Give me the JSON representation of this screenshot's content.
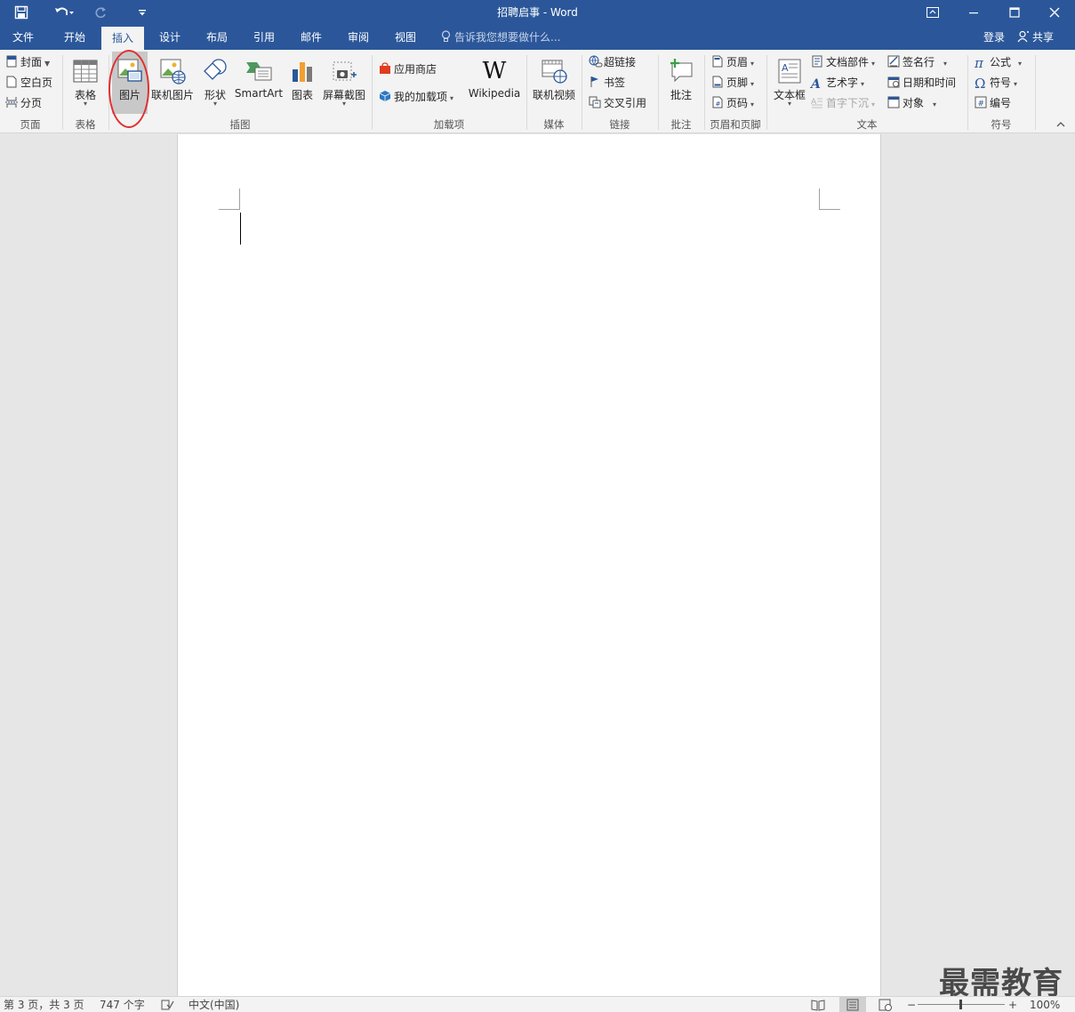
{
  "titlebar": {
    "title": "招聘启事 - Word",
    "save_icon": "save-icon",
    "undo_icon": "undo-icon",
    "redo_icon": "redo-icon",
    "customize_icon": "customize-quick-access-icon"
  },
  "tabs": [
    {
      "label": "文件"
    },
    {
      "label": "开始"
    },
    {
      "label": "插入",
      "active": true
    },
    {
      "label": "设计"
    },
    {
      "label": "布局"
    },
    {
      "label": "引用"
    },
    {
      "label": "邮件"
    },
    {
      "label": "审阅"
    },
    {
      "label": "视图"
    }
  ],
  "tellme": "告诉我您想要做什么...",
  "account": {
    "login": "登录",
    "share": "共享"
  },
  "ribbon": {
    "pages": {
      "cover": "封面",
      "blank": "空白页",
      "break": "分页",
      "group": "页面"
    },
    "tables": {
      "table": "表格",
      "group": "表格"
    },
    "illustrations": {
      "picture": "图片",
      "online_picture": "联机图片",
      "shapes": "形状",
      "smartart": "SmartArt",
      "chart": "图表",
      "screenshot": "屏幕截图",
      "group": "插图"
    },
    "addins": {
      "store": "应用商店",
      "my_addins": "我的加载项",
      "wikipedia": "Wikipedia",
      "group": "加载项"
    },
    "media": {
      "online_video": "联机视频",
      "group": "媒体"
    },
    "links": {
      "hyperlink": "超链接",
      "bookmark": "书签",
      "crossref": "交叉引用",
      "group": "链接"
    },
    "comments": {
      "comment": "批注",
      "group": "批注"
    },
    "header_footer": {
      "header": "页眉",
      "footer": "页脚",
      "page_number": "页码",
      "group": "页眉和页脚"
    },
    "text": {
      "textbox": "文本框",
      "quick_parts": "文档部件",
      "wordart": "艺术字",
      "dropcap": "首字下沉",
      "signature": "签名行",
      "datetime": "日期和时间",
      "object": "对象",
      "group": "文本"
    },
    "symbols": {
      "equation": "公式",
      "symbol": "符号",
      "number": "编号",
      "group": "符号"
    }
  },
  "watermark": "最需教育",
  "status": {
    "page": "第 3 页，共 3 页",
    "words": "747 个字",
    "language": "中文(中国)",
    "zoom": "100%"
  },
  "colors": {
    "accent": "#2b579a",
    "highlight_circle": "#e03030"
  }
}
